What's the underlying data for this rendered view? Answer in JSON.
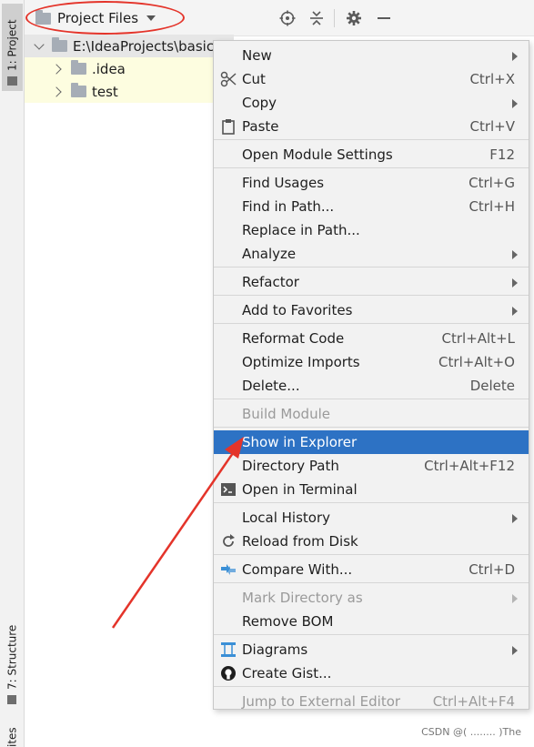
{
  "left_toolbar": {
    "project_tab": "1: Project",
    "structure_tab": "7: Structure",
    "favorites_tab": "ites"
  },
  "header": {
    "view_label": "Project Files",
    "buttons": [
      "target-icon",
      "collapse-icon",
      "gear-icon",
      "minimize-icon"
    ]
  },
  "tree": {
    "root_label": "E:\\IdeaProjects\\basic-",
    "children": [
      ".idea",
      "test"
    ]
  },
  "menu": {
    "groups": [
      [
        {
          "label": "New",
          "shortcut": "",
          "submenu": true
        },
        {
          "label": "Cut",
          "shortcut": "Ctrl+X",
          "icon": "scissors-icon"
        },
        {
          "label": "Copy",
          "shortcut": "",
          "submenu": true
        },
        {
          "label": "Paste",
          "shortcut": "Ctrl+V",
          "icon": "clipboard-icon"
        }
      ],
      [
        {
          "label": "Open Module Settings",
          "shortcut": "F12"
        }
      ],
      [
        {
          "label": "Find Usages",
          "shortcut": "Ctrl+G"
        },
        {
          "label": "Find in Path...",
          "shortcut": "Ctrl+H"
        },
        {
          "label": "Replace in Path...",
          "shortcut": ""
        },
        {
          "label": "Analyze",
          "shortcut": "",
          "submenu": true
        }
      ],
      [
        {
          "label": "Refactor",
          "shortcut": "",
          "submenu": true
        }
      ],
      [
        {
          "label": "Add to Favorites",
          "shortcut": "",
          "submenu": true
        }
      ],
      [
        {
          "label": "Reformat Code",
          "shortcut": "Ctrl+Alt+L"
        },
        {
          "label": "Optimize Imports",
          "shortcut": "Ctrl+Alt+O"
        },
        {
          "label": "Delete...",
          "shortcut": "Delete"
        }
      ],
      [
        {
          "label": "Build Module",
          "shortcut": "",
          "disabled": true
        }
      ],
      [
        {
          "label": "Show in Explorer",
          "shortcut": "",
          "highlighted": true
        },
        {
          "label": "Directory Path",
          "shortcut": "Ctrl+Alt+F12"
        },
        {
          "label": "Open in Terminal",
          "shortcut": "",
          "icon": "terminal-icon"
        }
      ],
      [
        {
          "label": "Local History",
          "shortcut": "",
          "submenu": true
        },
        {
          "label": "Reload from Disk",
          "shortcut": "",
          "icon": "reload-icon"
        }
      ],
      [
        {
          "label": "Compare With...",
          "shortcut": "Ctrl+D",
          "icon": "compare-icon"
        }
      ],
      [
        {
          "label": "Mark Directory as",
          "shortcut": "",
          "submenu": true,
          "disabled": true
        },
        {
          "label": "Remove BOM",
          "shortcut": ""
        }
      ],
      [
        {
          "label": "Diagrams",
          "shortcut": "",
          "submenu": true,
          "icon": "diagrams-icon"
        },
        {
          "label": "Create Gist...",
          "shortcut": "",
          "icon": "github-icon"
        }
      ],
      [
        {
          "label": "Jump to External Editor",
          "shortcut": "Ctrl+Alt+F4",
          "disabled": true
        }
      ]
    ]
  },
  "watermark": "CSDN @( ........ )The",
  "colors": {
    "highlight": "#2d72c4",
    "annotation_red": "#e4342a",
    "tree_bg": "#fdfde0"
  }
}
